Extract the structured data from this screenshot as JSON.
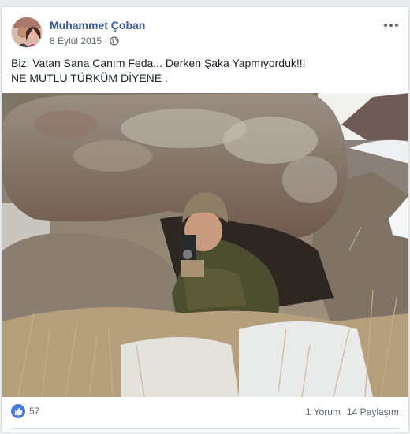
{
  "post": {
    "author": "Muhammet Çoban",
    "date": "8 Eylül 2015",
    "separator": "·",
    "privacy_icon": "globe-icon",
    "more_icon": "more-options-icon",
    "text_lines": [
      "Biz; Vatan Sana Canım Feda... Derken Şaka Yapmıyorduk!!!",
      "NE MUTLU TÜRKÜM DİYENE ."
    ]
  },
  "footer": {
    "like_count": "57",
    "comments": "1 Yorum",
    "shares": "14 Paylaşım"
  },
  "colors": {
    "author_link": "#385898",
    "like_badge": "#4b7bd8",
    "meta_text": "#616770"
  }
}
